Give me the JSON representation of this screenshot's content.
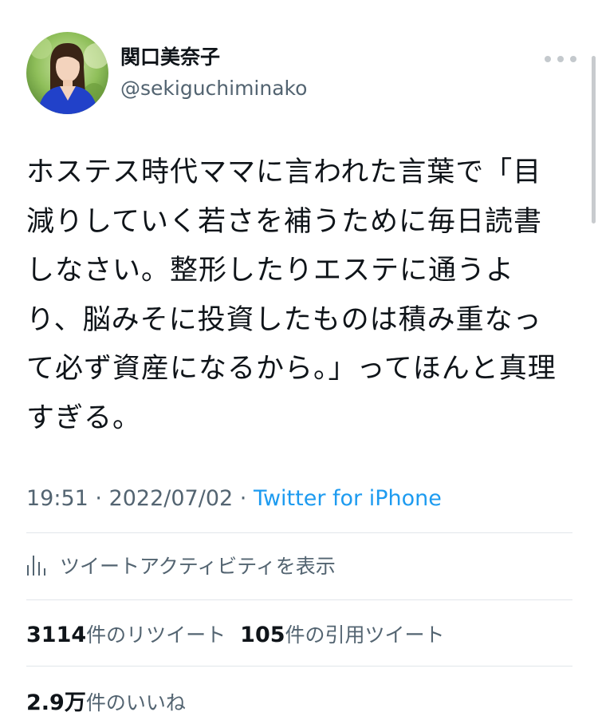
{
  "user": {
    "display_name": "関口美奈子",
    "handle": "@sekiguchiminako",
    "avatar_icon": "profile-photo"
  },
  "tweet": {
    "text": "ホステス時代ママに言われた言葉で「目減りしていく若さを補うために毎日読書しなさい。整形したりエステに通うより、脳みそに投資したものは積み重なって必ず資産になるから。」ってほんと真理すぎる。",
    "time": "19:51",
    "separator": " · ",
    "date": "2022/07/02",
    "source": "Twitter for iPhone"
  },
  "activity": {
    "label": "ツイートアクティビティを表示",
    "icon": "bar-chart-icon"
  },
  "stats": {
    "retweets_count": "3114",
    "retweets_label": "件のリツイート",
    "quotes_count": "105",
    "quotes_label": "件の引用ツイート",
    "likes_count": "2.9万",
    "likes_label": "件のいいね"
  },
  "colors": {
    "link": "#1d9bf0",
    "muted": "#536471",
    "text": "#0f1419",
    "divider": "#e1e6ea"
  }
}
